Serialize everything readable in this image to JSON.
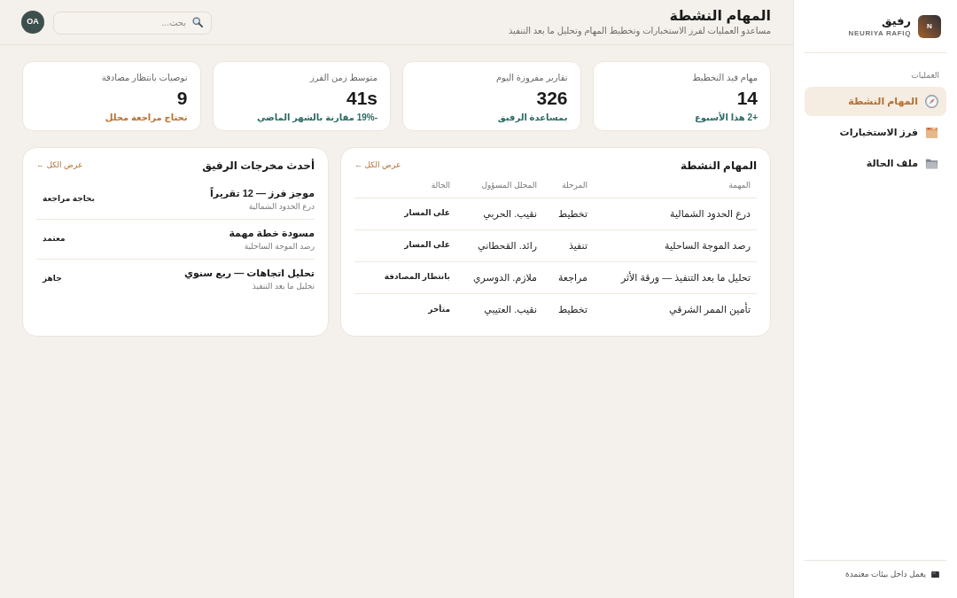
{
  "sidebar": {
    "logo": {
      "mark": "N"
    },
    "brand": {
      "name": "رفيق",
      "subtitle": "NEURIYA RAFIQ"
    },
    "section_label": "العمليات",
    "items": [
      {
        "label": "المهام النشطة",
        "selected": true
      },
      {
        "label": "فرز الاستخبارات",
        "selected": false
      },
      {
        "label": "ملف الحالة",
        "selected": false
      }
    ],
    "footer": {
      "text": "يعمل داخل بيئات معتمدة"
    }
  },
  "header": {
    "title": "المهام النشطة",
    "subtitle": "مساعدو العمليات لفرز الاستخبارات وتخطيط المهام وتحليل ما بعد التنفيذ",
    "search": {
      "placeholder": "بحث..."
    },
    "avatar": {
      "initials": "OA"
    }
  },
  "stats": [
    {
      "label": "مهام قيد التخطيط",
      "value": "14",
      "note": "+2 هذا الأسبوع",
      "color": "#2b6a64"
    },
    {
      "label": "تقارير مفروزة اليوم",
      "value": "326",
      "note": "بمساعدة الرفيق",
      "color": "#2b6a64"
    },
    {
      "label": "متوسط زمن الفرز",
      "value": "41s",
      "note": "-19% مقارنة بالشهر الماضي",
      "color": "#2b6a64"
    },
    {
      "label": "توصيات بانتظار مصادقة",
      "value": "9",
      "note": "تحتاج مراجعة محلل",
      "color": "#b8702e"
    }
  ],
  "tasks_panel": {
    "title": "المهام النشطة",
    "link": "عرض الكل ←",
    "columns": [
      "المهمة",
      "المرحلة",
      "المحلل المسؤول",
      "الحالة"
    ],
    "rows": [
      [
        "درع الحدود الشمالية",
        "تخطيط",
        "نقيب. الحربي",
        "على المسار"
      ],
      [
        "رصد الموجة الساحلية",
        "تنفيذ",
        "رائد. القحطاني",
        "على المسار"
      ],
      [
        "تحليل ما بعد التنفيذ — ورقة الأثر",
        "مراجعة",
        "ملازم. الدوسري",
        "بانتظار المصادقة"
      ],
      [
        "تأمين الممر الشرقي",
        "تخطيط",
        "نقيب. العتيبي",
        "متأخر"
      ]
    ]
  },
  "outputs_panel": {
    "title": "أحدث مخرجات الرفيق",
    "link": "عرض الكل ←",
    "items": [
      {
        "title": "موجز فرز — 12 تقريراً",
        "subtitle": "درع الحدود الشمالية",
        "status": "بحاجة مراجعة"
      },
      {
        "title": "مسودة خطة مهمة",
        "subtitle": "رصد الموجة الساحلية",
        "status": "معتمد"
      },
      {
        "title": "تحليل اتجاهات — ربع سنوي",
        "subtitle": "تحليل ما بعد التنفيذ",
        "status": "جاهز"
      }
    ]
  }
}
